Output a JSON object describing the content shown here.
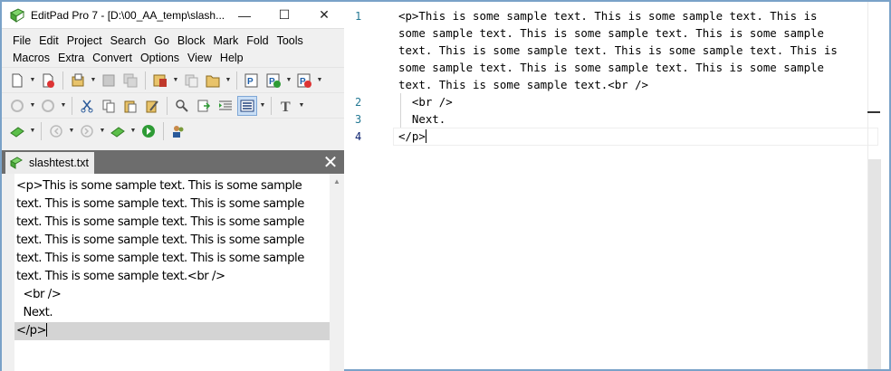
{
  "window": {
    "title": "EditPad Pro 7 - [D:\\00_AA_temp\\slash...",
    "controls": {
      "minimize": "—",
      "maximize": "☐",
      "close": "✕"
    }
  },
  "menu": [
    "File",
    "Edit",
    "Project",
    "Search",
    "Go",
    "Block",
    "Mark",
    "Fold",
    "Tools",
    "Macros",
    "Extra",
    "Convert",
    "Options",
    "View",
    "Help"
  ],
  "tab": {
    "label": "slashtest.txt",
    "close": "✕"
  },
  "left_editor": {
    "lines": [
      "<p>This is some sample text. This is some sample",
      "text. This is some sample text. This is some sample",
      "text. This is some sample text. This is some sample",
      "text. This is some sample text. This is some sample",
      "text. This is some sample text. This is some sample",
      "text. This is some sample text.<br />",
      "  <br />",
      "  Next.",
      "</p>"
    ]
  },
  "right_editor": {
    "line_numbers": [
      "1",
      "2",
      "3",
      "4"
    ],
    "lines": [
      "<p>This is some sample text. This is some sample text. This is",
      "some sample text. This is some sample text. This is some sample",
      "text. This is some sample text. This is some sample text. This is",
      "some sample text. This is some sample text. This is some sample",
      "text. This is some sample text.<br />",
      "  <br />",
      "  Next.",
      "</p>"
    ]
  },
  "icons": {
    "app": "editpad-book-icon",
    "toolbar_row1": [
      "new-file-icon",
      "close-file-icon",
      "open-file-icon",
      "save-icon",
      "save-all-icon",
      "open-folder-icon",
      "copy-file-icon",
      "project-open-icon",
      "project-add-icon",
      "project-remove-icon"
    ],
    "toolbar_row2": [
      "undo-icon",
      "redo-icon",
      "cut-icon",
      "copy-icon",
      "paste-icon",
      "edit-icon",
      "find-icon",
      "replace-icon",
      "indent-icon",
      "block-select-icon",
      "font-icon"
    ],
    "toolbar_row3": [
      "book-icon",
      "back-icon",
      "forward-icon",
      "clip-icon",
      "run-icon",
      "users-icon"
    ]
  },
  "colors": {
    "accent": "#7aa2c8",
    "line_number": "#237893",
    "tab_bar": "#6d6d6d"
  }
}
